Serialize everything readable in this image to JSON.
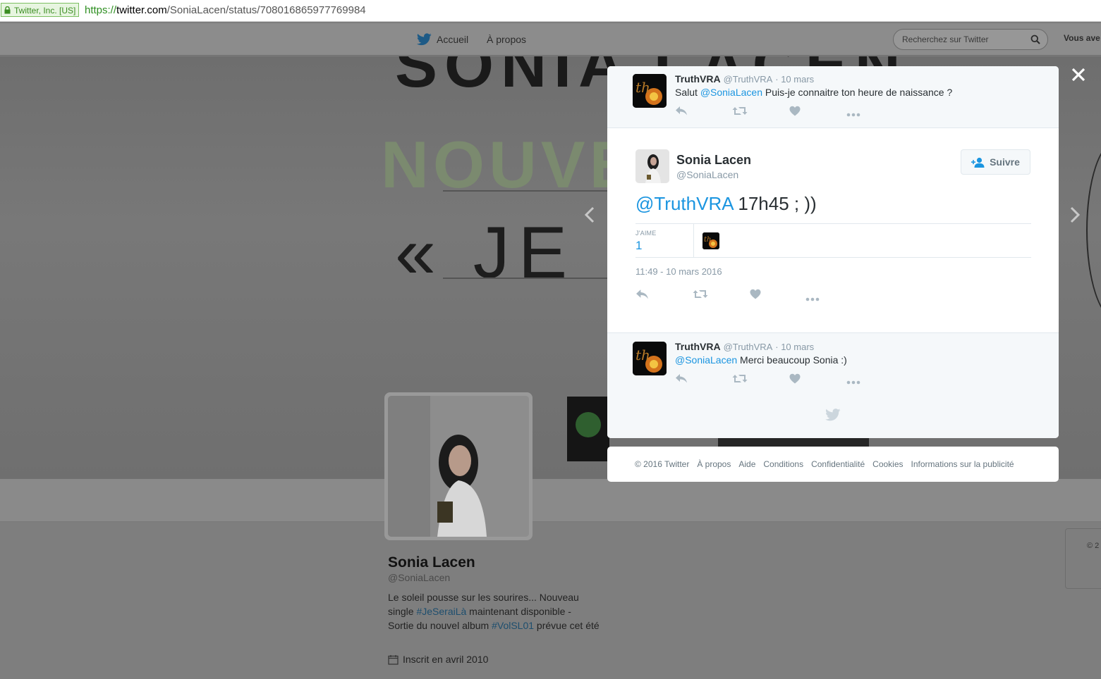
{
  "browser": {
    "cert_label": "Twitter, Inc. [US]",
    "url_scheme": "https://",
    "url_host": "twitter.com",
    "url_path": "/SoniaLacen/status/708016865977769984"
  },
  "nav": {
    "home": "Accueil",
    "about": "À propos",
    "search_placeholder": "Recherchez sur Twitter",
    "account_label": "Vous ave"
  },
  "profile": {
    "name": "Sonia Lacen",
    "handle": "@SoniaLacen",
    "bio_1": "Le soleil pousse sur les sourires... Nouveau single ",
    "bio_tag1": "#JeSeraiLà",
    "bio_2": " maintenant disponible - Sortie du nouvel album ",
    "bio_tag2": "#VolSL01",
    "bio_3": " prévue cet été",
    "joined": "Inscrit en avril 2010",
    "side_copyright": "© 2"
  },
  "modal": {
    "parent_tweet": {
      "name": "TruthVRA",
      "handle": "@TruthVRA",
      "date": "· 10 mars",
      "text_before": "Salut ",
      "mention": "@SoniaLacen",
      "text_after": " Puis-je connaitre ton heure de naissance ?"
    },
    "main_tweet": {
      "name": "Sonia Lacen",
      "handle": "@SoniaLacen",
      "follow_label": "Suivre",
      "mention": "@TruthVRA",
      "text_after": " 17h45 ; ))",
      "likes_label": "J'AIME",
      "likes_count": "1",
      "timestamp": "11:49 - 10 mars 2016"
    },
    "reply_tweet": {
      "name": "TruthVRA",
      "handle": "@TruthVRA",
      "date": "· 10 mars",
      "mention": "@SoniaLacen",
      "text_after": " Merci beaucoup Sonia :)"
    }
  },
  "footer": {
    "links": [
      "© 2016 Twitter",
      "À propos",
      "Aide",
      "Conditions",
      "Confidentialité",
      "Cookies",
      "Informations sur la publicité"
    ]
  },
  "colors": {
    "link": "#1b95e0",
    "muted": "#8899a6",
    "text": "#292f33"
  }
}
